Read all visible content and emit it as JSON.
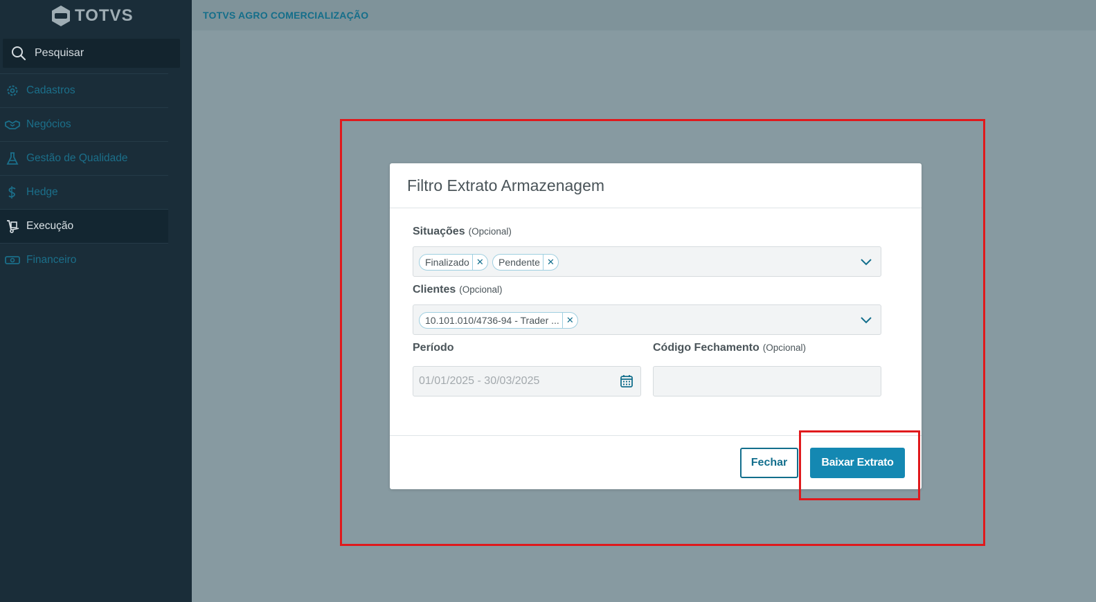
{
  "brand": {
    "logo_text": "TOTVS"
  },
  "sidebar": {
    "search_label": "Pesquisar",
    "items": [
      {
        "label": "Cadastros",
        "icon": "gear-icon",
        "active": false
      },
      {
        "label": "Negócios",
        "icon": "handshake-icon",
        "active": false
      },
      {
        "label": "Gestão de Qualidade",
        "icon": "flask-icon",
        "active": false
      },
      {
        "label": "Hedge",
        "icon": "hedge-icon",
        "active": false
      },
      {
        "label": "Execução",
        "icon": "hand-truck-icon",
        "active": true
      },
      {
        "label": "Financeiro",
        "icon": "money-icon",
        "active": false
      }
    ]
  },
  "header": {
    "app_title": "TOTVS AGRO COMERCIALIZAÇÃO"
  },
  "modal": {
    "title": "Filtro Extrato Armazenagem",
    "situacoes": {
      "label": "Situações",
      "optional": "(Opcional)",
      "chips": [
        "Finalizado",
        "Pendente"
      ]
    },
    "clientes": {
      "label": "Clientes",
      "optional": "(Opcional)",
      "chips": [
        "10.101.010/4736-94 - Trader ..."
      ]
    },
    "periodo": {
      "label": "Período",
      "value": "01/01/2025 - 30/03/2025"
    },
    "codigo_fechamento": {
      "label": "Código Fechamento",
      "optional": "(Opcional)",
      "value": ""
    },
    "buttons": {
      "close": "Fechar",
      "download": "Baixar Extrato"
    }
  },
  "colors": {
    "primary": "#1488b2",
    "sidebar_bg": "#1a2d39",
    "overlay": "#879aa1",
    "annotation": "#e0191c"
  }
}
